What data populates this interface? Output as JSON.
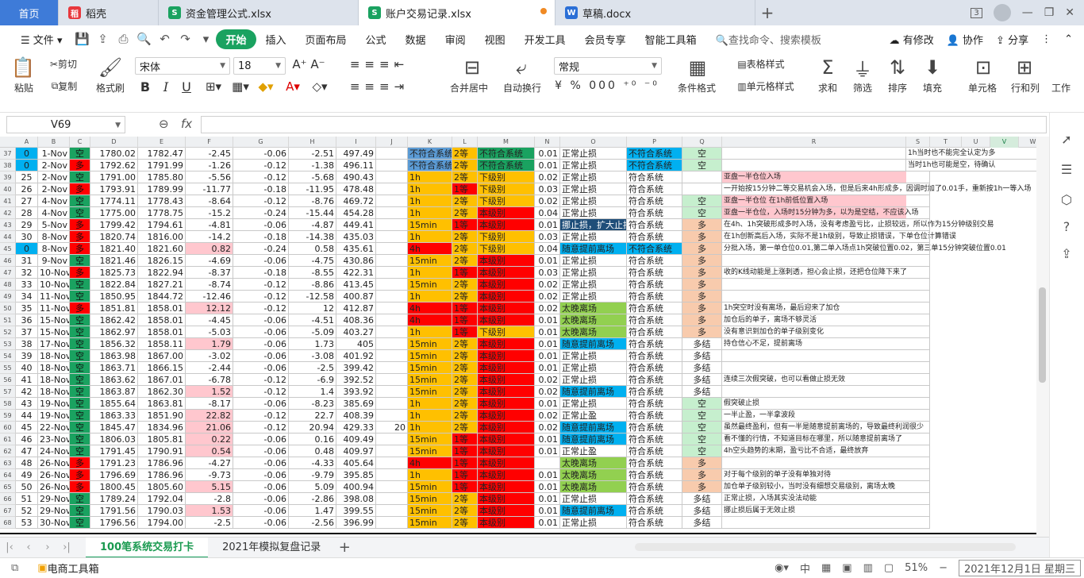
{
  "tabs": [
    {
      "label": "首页",
      "icon": "",
      "color": "",
      "home": true
    },
    {
      "label": "稻壳",
      "icon": "稻",
      "color": "#e8383d"
    },
    {
      "label": "资金管理公式.xlsx",
      "icon": "S",
      "color": "#1aa260"
    },
    {
      "label": "账户交易记录.xlsx",
      "icon": "S",
      "color": "#1aa260",
      "active": true
    },
    {
      "label": "草稿.docx",
      "icon": "W",
      "color": "#2b6fd6"
    }
  ],
  "tab_badge": "3",
  "menu": {
    "file": "文件",
    "items": [
      "开始",
      "插入",
      "页面布局",
      "公式",
      "数据",
      "审阅",
      "视图",
      "开发工具",
      "会员专享",
      "智能工具箱"
    ],
    "search": "查找命令、搜索模板",
    "right": [
      "有修改",
      "协作",
      "分享"
    ]
  },
  "ribbon": {
    "paste": "粘贴",
    "cut": "剪切",
    "copy": "复制",
    "format_painter": "格式刷",
    "font": "宋体",
    "size": "18",
    "merge": "合并居中",
    "wrap": "自动换行",
    "numfmt": "常规",
    "cond": "条件格式",
    "table_style": "表格样式",
    "cell_style": "单元格样式",
    "sum": "求和",
    "filter": "筛选",
    "sort": "排序",
    "fill": "填充",
    "cell": "单元格",
    "rowcol": "行和列",
    "worksheet": "工作"
  },
  "namebox": "V69",
  "fx": "fx",
  "columns": [
    "A",
    "B",
    "C",
    "D",
    "E",
    "F",
    "G",
    "H",
    "I",
    "J",
    "K",
    "L",
    "M",
    "N",
    "O",
    "P",
    "Q",
    "R",
    "S",
    "T",
    "U",
    "V",
    "W"
  ],
  "selected_column": "V",
  "rows": [
    [
      "37",
      "0",
      "1-Nov",
      "空",
      "1780.02",
      "1782.47",
      "-2.45",
      "-0.06",
      "-2.51",
      "497.49",
      "",
      "不符合系统",
      "2等",
      "不符合系统",
      "0.01",
      "正常止损",
      "不符合系统",
      "空",
      "",
      "1h当时也不能完全认定为多"
    ],
    [
      "38",
      "0",
      "2-Nov",
      "多",
      "1792.62",
      "1791.99",
      "-1.26",
      "-0.12",
      "-1.38",
      "496.11",
      "",
      "不符合系统",
      "2等",
      "不符合系统",
      "0.01",
      "正常止损",
      "不符合系统",
      "空",
      "",
      "当时1h也可能是空，待确认"
    ],
    [
      "39",
      "25",
      "2-Nov",
      "空",
      "1791.00",
      "1785.80",
      "-5.56",
      "-0.12",
      "-5.68",
      "490.43",
      "",
      "1h",
      "2等",
      "下级别",
      "0.02",
      "正常止损",
      "符合系统",
      "",
      "亚盘一半仓位入场",
      ""
    ],
    [
      "40",
      "26",
      "2-Nov",
      "多",
      "1793.91",
      "1789.99",
      "-11.77",
      "-0.18",
      "-11.95",
      "478.48",
      "",
      "1h",
      "1等",
      "下级别",
      "0.03",
      "正常止损",
      "符合系统",
      "",
      "一开始按15分钟二等交易机会入场，但是后来4h形成多，因调时加了0.01手，重新按1h一等入场",
      ""
    ],
    [
      "41",
      "27",
      "4-Nov",
      "空",
      "1774.11",
      "1778.43",
      "-8.64",
      "-0.12",
      "-8.76",
      "469.72",
      "",
      "1h",
      "2等",
      "下级别",
      "0.02",
      "正常止损",
      "符合系统",
      "空",
      "亚盘一半仓位  在1h前低位置入场",
      ""
    ],
    [
      "42",
      "28",
      "4-Nov",
      "空",
      "1775.00",
      "1778.75",
      "-15.2",
      "-0.24",
      "-15.44",
      "454.28",
      "",
      "1h",
      "2等",
      "本级别",
      "0.04",
      "正常止损",
      "符合系统",
      "空",
      "亚盘一半仓位，入场时15分钟为多，以为是空结，不应该入场",
      ""
    ],
    [
      "43",
      "29",
      "5-Nov",
      "多",
      "1799.42",
      "1794.61",
      "-4.81",
      "-0.06",
      "-4.87",
      "449.41",
      "",
      "15min",
      "1等",
      "本级别",
      "0.01",
      "挪止损，扩大止损",
      "符合系统",
      "多",
      "在4h、1h突破形成多时入场，没有考虑盈亏比，止损较远，所以作为15分钟级别交易",
      ""
    ],
    [
      "44",
      "30",
      "8-Nov",
      "多",
      "1820.74",
      "1816.00",
      "-14.2",
      "-0.18",
      "-14.38",
      "435.03",
      "",
      "1h",
      "2等",
      "下级别",
      "0.03",
      "正常止损",
      "符合系统",
      "多",
      "在1h创新高后入场，实际不是1h级别，导致止损错误，下单仓位计算错误",
      ""
    ],
    [
      "45",
      "0",
      "8-Nov",
      "多",
      "1821.40",
      "1821.60",
      "0.82",
      "-0.24",
      "0.58",
      "435.61",
      "",
      "4h",
      "2等",
      "下级别",
      "0.04",
      "随意提前离场",
      "不符合系统",
      "多",
      "分批入场，第一单仓位0.01,第二单入场点1h突破位置0.02，第三单15分钟突破位置0.01",
      ""
    ],
    [
      "46",
      "31",
      "9-Nov",
      "空",
      "1821.46",
      "1826.15",
      "-4.69",
      "-0.06",
      "-4.75",
      "430.86",
      "",
      "15min",
      "2等",
      "本级别",
      "0.01",
      "正常止损",
      "符合系统",
      "多",
      "",
      ""
    ],
    [
      "47",
      "32",
      "10-Nov",
      "多",
      "1825.73",
      "1822.94",
      "-8.37",
      "-0.18",
      "-8.55",
      "422.31",
      "",
      "1h",
      "1等",
      "本级别",
      "0.03",
      "正常止损",
      "符合系统",
      "多",
      "收的K线动能是上涨刺透，担心会止损，还把仓位降下来了",
      ""
    ],
    [
      "48",
      "33",
      "10-Nov",
      "空",
      "1822.84",
      "1827.21",
      "-8.74",
      "-0.12",
      "-8.86",
      "413.45",
      "",
      "15min",
      "2等",
      "本级别",
      "0.02",
      "正常止损",
      "符合系统",
      "多",
      "",
      ""
    ],
    [
      "49",
      "34",
      "11-Nov",
      "空",
      "1850.95",
      "1844.72",
      "-12.46",
      "-0.12",
      "-12.58",
      "400.87",
      "",
      "1h",
      "2等",
      "本级别",
      "0.02",
      "正常止损",
      "符合系统",
      "多",
      "",
      ""
    ],
    [
      "50",
      "35",
      "11-Nov",
      "多",
      "1851.81",
      "1858.01",
      "12.12",
      "-0.12",
      "12",
      "412.87",
      "",
      "4h",
      "1等",
      "本级别",
      "0.02",
      "太晚离场",
      "符合系统",
      "多",
      "1h突空时没有离场，最后迎来了加仓",
      ""
    ],
    [
      "51",
      "36",
      "15-Nov",
      "空",
      "1862.42",
      "1858.01",
      "-4.45",
      "-0.06",
      "-4.51",
      "408.36",
      "",
      "4h",
      "1等",
      "本级别",
      "0.01",
      "太晚离场",
      "符合系统",
      "多",
      "加仓后的单子，离场不够灵活",
      ""
    ],
    [
      "52",
      "37",
      "15-Nov",
      "空",
      "1862.97",
      "1858.01",
      "-5.03",
      "-0.06",
      "-5.09",
      "403.27",
      "",
      "1h",
      "1等",
      "下级别",
      "0.01",
      "太晚离场",
      "符合系统",
      "多",
      "没有意识到加仓的单子级别变化",
      ""
    ],
    [
      "53",
      "38",
      "17-Nov",
      "空",
      "1856.32",
      "1858.11",
      "1.79",
      "-0.06",
      "1.73",
      "405",
      "",
      "15min",
      "2等",
      "本级别",
      "0.01",
      "随意提前离场",
      "符合系统",
      "多结",
      "持仓信心不足，提前离场",
      ""
    ],
    [
      "54",
      "39",
      "18-Nov",
      "空",
      "1863.98",
      "1867.00",
      "-3.02",
      "-0.06",
      "-3.08",
      "401.92",
      "",
      "15min",
      "2等",
      "本级别",
      "0.01",
      "正常止损",
      "符合系统",
      "多结",
      "",
      ""
    ],
    [
      "55",
      "40",
      "18-Nov",
      "空",
      "1863.71",
      "1866.15",
      "-2.44",
      "-0.06",
      "-2.5",
      "399.42",
      "",
      "15min",
      "2等",
      "本级别",
      "0.01",
      "正常止损",
      "符合系统",
      "多结",
      "",
      ""
    ],
    [
      "56",
      "41",
      "18-Nov",
      "空",
      "1863.62",
      "1867.01",
      "-6.78",
      "-0.12",
      "-6.9",
      "392.52",
      "",
      "15min",
      "2等",
      "本级别",
      "0.02",
      "正常止损",
      "符合系统",
      "多结",
      "连续三次假突破，也可以看做止损无效",
      ""
    ],
    [
      "57",
      "42",
      "18-Nov",
      "空",
      "1863.87",
      "1862.30",
      "1.52",
      "-0.12",
      "1.4",
      "393.92",
      "",
      "15min",
      "2等",
      "本级别",
      "0.02",
      "随意提前离场",
      "符合系统",
      "多结",
      "",
      ""
    ],
    [
      "58",
      "43",
      "19-Nov",
      "空",
      "1855.64",
      "1863.81",
      "-8.17",
      "-0.06",
      "-8.23",
      "385.69",
      "",
      "1h",
      "2等",
      "本级别",
      "0.01",
      "正常止损",
      "符合系统",
      "空",
      "假突破止损",
      ""
    ],
    [
      "59",
      "44",
      "19-Nov",
      "空",
      "1863.33",
      "1851.90",
      "22.82",
      "-0.12",
      "22.7",
      "408.39",
      "",
      "1h",
      "2等",
      "本级别",
      "0.02",
      "正常止盈",
      "符合系统",
      "空",
      "一半止盈，一半拿波段",
      ""
    ],
    [
      "60",
      "45",
      "22-Nov",
      "空",
      "1845.47",
      "1834.96",
      "21.06",
      "-0.12",
      "20.94",
      "429.33",
      "20",
      "1h",
      "2等",
      "本级别",
      "0.02",
      "随意提前离场",
      "符合系统",
      "空",
      "虽然最终盈利，但有一半是随意提前离场的，导致最终利润很少",
      ""
    ],
    [
      "61",
      "46",
      "23-Nov",
      "空",
      "1806.03",
      "1805.81",
      "0.22",
      "-0.06",
      "0.16",
      "409.49",
      "",
      "15min",
      "1等",
      "本级别",
      "0.01",
      "随意提前离场",
      "符合系统",
      "空",
      "看不懂的行情，不知道目标在哪里，所以随意提前离场了",
      ""
    ],
    [
      "62",
      "47",
      "24-Nov",
      "空",
      "1791.45",
      "1790.91",
      "0.54",
      "-0.06",
      "0.48",
      "409.97",
      "",
      "15min",
      "1等",
      "本级别",
      "0.01",
      "正常止盈",
      "符合系统",
      "空",
      "4h空头趋势的末期，盈亏比不合适，最终放弃",
      ""
    ],
    [
      "63",
      "48",
      "26-Nov",
      "多",
      "1791.23",
      "1786.96",
      "-4.27",
      "-0.06",
      "-4.33",
      "405.64",
      "",
      "4h",
      "1等",
      "本级别",
      "",
      "太晚离场",
      "符合系统",
      "多",
      "",
      ""
    ],
    [
      "64",
      "49",
      "26-Nov",
      "多",
      "1796.69",
      "1786.96",
      "-9.73",
      "-0.06",
      "-9.79",
      "395.85",
      "",
      "1h",
      "1等",
      "本级别",
      "0.01",
      "太晚离场",
      "符合系统",
      "多",
      "对于每个级别的单子没有单独对待",
      ""
    ],
    [
      "65",
      "50",
      "26-Nov",
      "多",
      "1800.45",
      "1805.60",
      "5.15",
      "-0.06",
      "5.09",
      "400.94",
      "",
      "15min",
      "1等",
      "本级别",
      "0.01",
      "太晚离场",
      "符合系统",
      "多",
      "加仓单子级别较小，当时没有细想交易级别，离场太晚",
      ""
    ],
    [
      "66",
      "51",
      "29-Nov",
      "空",
      "1789.24",
      "1792.04",
      "-2.8",
      "-0.06",
      "-2.86",
      "398.08",
      "",
      "15min",
      "2等",
      "本级别",
      "0.01",
      "正常止损",
      "符合系统",
      "多结",
      "正常止损，入场其实没法动能",
      ""
    ],
    [
      "67",
      "52",
      "29-Nov",
      "空",
      "1791.56",
      "1790.03",
      "1.53",
      "-0.06",
      "1.47",
      "399.55",
      "",
      "15min",
      "2等",
      "本级别",
      "0.01",
      "随意提前离场",
      "符合系统",
      "多结",
      "挪止损后属于无效止损",
      ""
    ],
    [
      "68",
      "53",
      "30-Nov",
      "空",
      "1796.56",
      "1794.00",
      "-2.5",
      "-0.06",
      "-2.56",
      "396.99",
      "",
      "15min",
      "2等",
      "本级别",
      "0.01",
      "正常止损",
      "符合系统",
      "多结",
      "",
      ""
    ]
  ],
  "sheets": [
    "100笔系统交易打卡",
    "2021年模拟复盘记录"
  ],
  "status": {
    "left": "电商工具箱",
    "zoom": "51%",
    "datetime": "2021年12月1日 星期三",
    "ime": "中"
  },
  "colors": {
    "green": "#1aa260",
    "red": "#ff0000",
    "orange": "#ffc000",
    "yellow": "#ffff00",
    "blue": "#00b0f0",
    "lime": "#92d050",
    "pink": "#ffc7ce",
    "lightgreen": "#c6efce",
    "salmon": "#f8cbad"
  }
}
